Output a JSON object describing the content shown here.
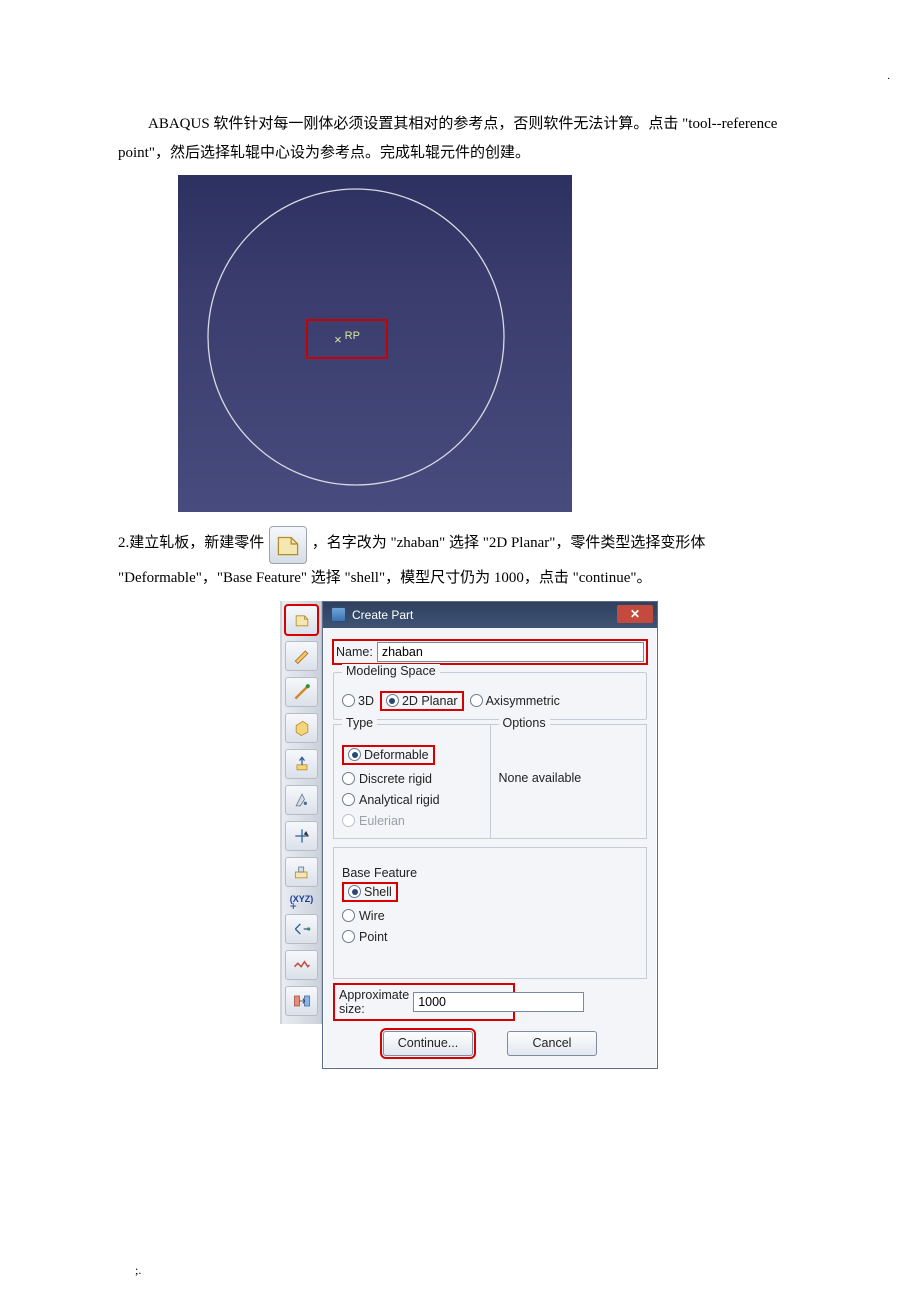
{
  "doc": {
    "top_dot": ".",
    "para1": "ABAQUS 软件针对每一刚体必须设置其相对的参考点，否则软件无法计算。点击 \"tool--reference point\"，然后选择轧辊中心设为参考点。完成轧辊元件的创建。",
    "rp_label": "RP",
    "para2_prefix": "2.建立轧板，新建零件 ",
    "para2_suffix": "，名字改为 \"zhaban\" 选择 \"2D  Planar\"，零件类型选择变形体 \"Deformable\"，\"Base Feature\" 选择 \"shell\"，模型尺寸仍为 1000，点击 \"continue\"。",
    "footer": ";."
  },
  "dialog": {
    "title": "Create Part",
    "name_label": "Name:",
    "name_value": "zhaban",
    "modeling_space": {
      "legend": "Modeling Space",
      "opt_3d": "3D",
      "opt_2d": "2D Planar",
      "opt_axi": "Axisymmetric"
    },
    "type": {
      "legend": "Type",
      "deformable": "Deformable",
      "discrete": "Discrete rigid",
      "analytical": "Analytical rigid",
      "eulerian": "Eulerian"
    },
    "options": {
      "legend": "Options",
      "value": "None available"
    },
    "base_feature": {
      "legend": "Base Feature",
      "shell": "Shell",
      "wire": "Wire",
      "point": "Point"
    },
    "approx_label": "Approximate size:",
    "approx_value": "1000",
    "continue_btn": "Continue...",
    "cancel_btn": "Cancel"
  },
  "toolbar": {
    "xyz": "(XYZ)"
  }
}
